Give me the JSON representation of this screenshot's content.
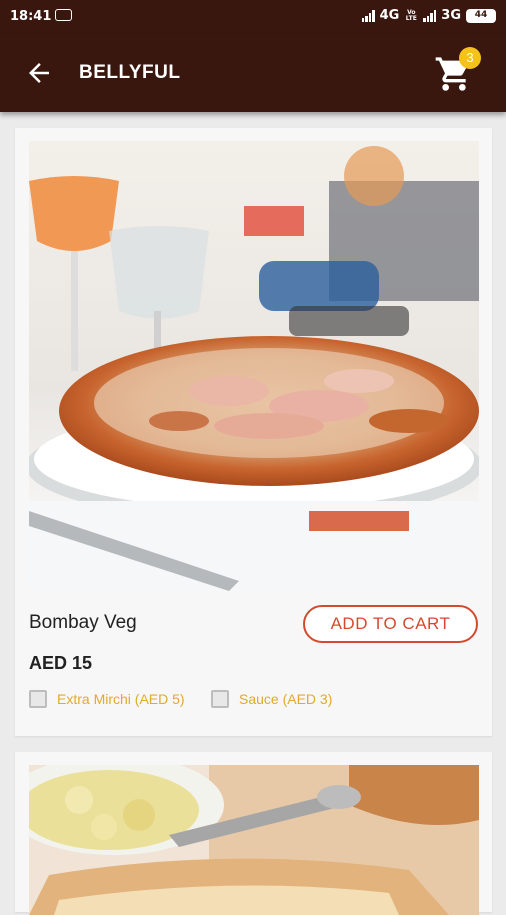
{
  "status_bar": {
    "time": "18:41",
    "vpn_label": "VPN",
    "network1": "4G",
    "volte": "Vo LTE",
    "network2": "3G",
    "battery": "44"
  },
  "app_bar": {
    "title": "BELLYFUL",
    "cart_count": "3",
    "back_icon": "arrow-back-icon",
    "cart_icon": "shopping-cart-icon"
  },
  "products": [
    {
      "name": "Bombay Veg",
      "price": "AED 15",
      "add_to_cart_label": "ADD TO CART",
      "addons": [
        {
          "label": "Extra Mirchi (AED 5)",
          "checked": false
        },
        {
          "label": "Sauce (AED 3)",
          "checked": false
        }
      ]
    }
  ],
  "colors": {
    "app_bar": "#3a170e",
    "accent": "#d54a2e",
    "addon_text": "#e1a92e",
    "badge": "#f4c21b"
  }
}
